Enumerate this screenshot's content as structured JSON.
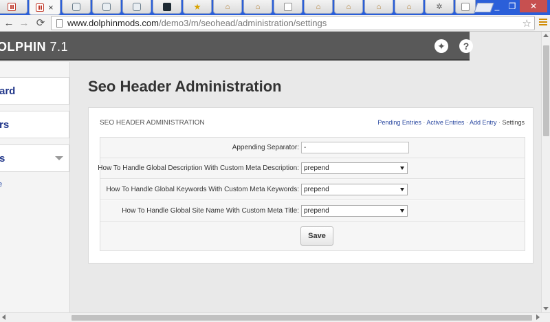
{
  "browser": {
    "url_host": "www.dolphinmods.com",
    "url_path": "/demo3/m/seohead/administration/settings",
    "tab_close_glyph": "×",
    "tabs": [
      {
        "icon": "pause-icon"
      },
      {
        "icon": "pause-icon",
        "active": true
      },
      {
        "icon": "dolphin-icon"
      },
      {
        "icon": "dolphin-icon"
      },
      {
        "icon": "dolphin-dark-icon"
      },
      {
        "icon": "star-icon"
      },
      {
        "icon": "house-icon"
      },
      {
        "icon": "house-icon"
      },
      {
        "icon": "document-icon"
      },
      {
        "icon": "house-icon"
      },
      {
        "icon": "house-icon"
      },
      {
        "icon": "house-icon"
      },
      {
        "icon": "house-icon"
      },
      {
        "icon": "gear-icon"
      },
      {
        "icon": "document-icon"
      }
    ]
  },
  "header": {
    "brand": "OLPHIN",
    "version": "7.1"
  },
  "sidebar": {
    "items": [
      {
        "label": "ard"
      },
      {
        "label": "rs"
      },
      {
        "label": "s"
      }
    ],
    "sub_link": "e"
  },
  "main": {
    "title": "Seo Header Administration",
    "panel": {
      "heading": "SEO HEADER ADMINISTRATION",
      "links": {
        "pending": "Pending Entries",
        "active": "Active Entries",
        "add": "Add Entry",
        "settings": "Settings",
        "separator": " · "
      },
      "fields": {
        "separator": {
          "label": "Appending Separator:",
          "value": "-"
        },
        "description": {
          "label": "How To Handle Global Description With Custom Meta Description:",
          "value": "prepend"
        },
        "keywords": {
          "label": "How To Handle Global Keywords With Custom Meta Keywords:",
          "value": "prepend"
        },
        "sitename": {
          "label": "How To Handle Global Site Name With Custom Meta Title:",
          "value": "prepend"
        }
      },
      "save_label": "Save"
    }
  }
}
